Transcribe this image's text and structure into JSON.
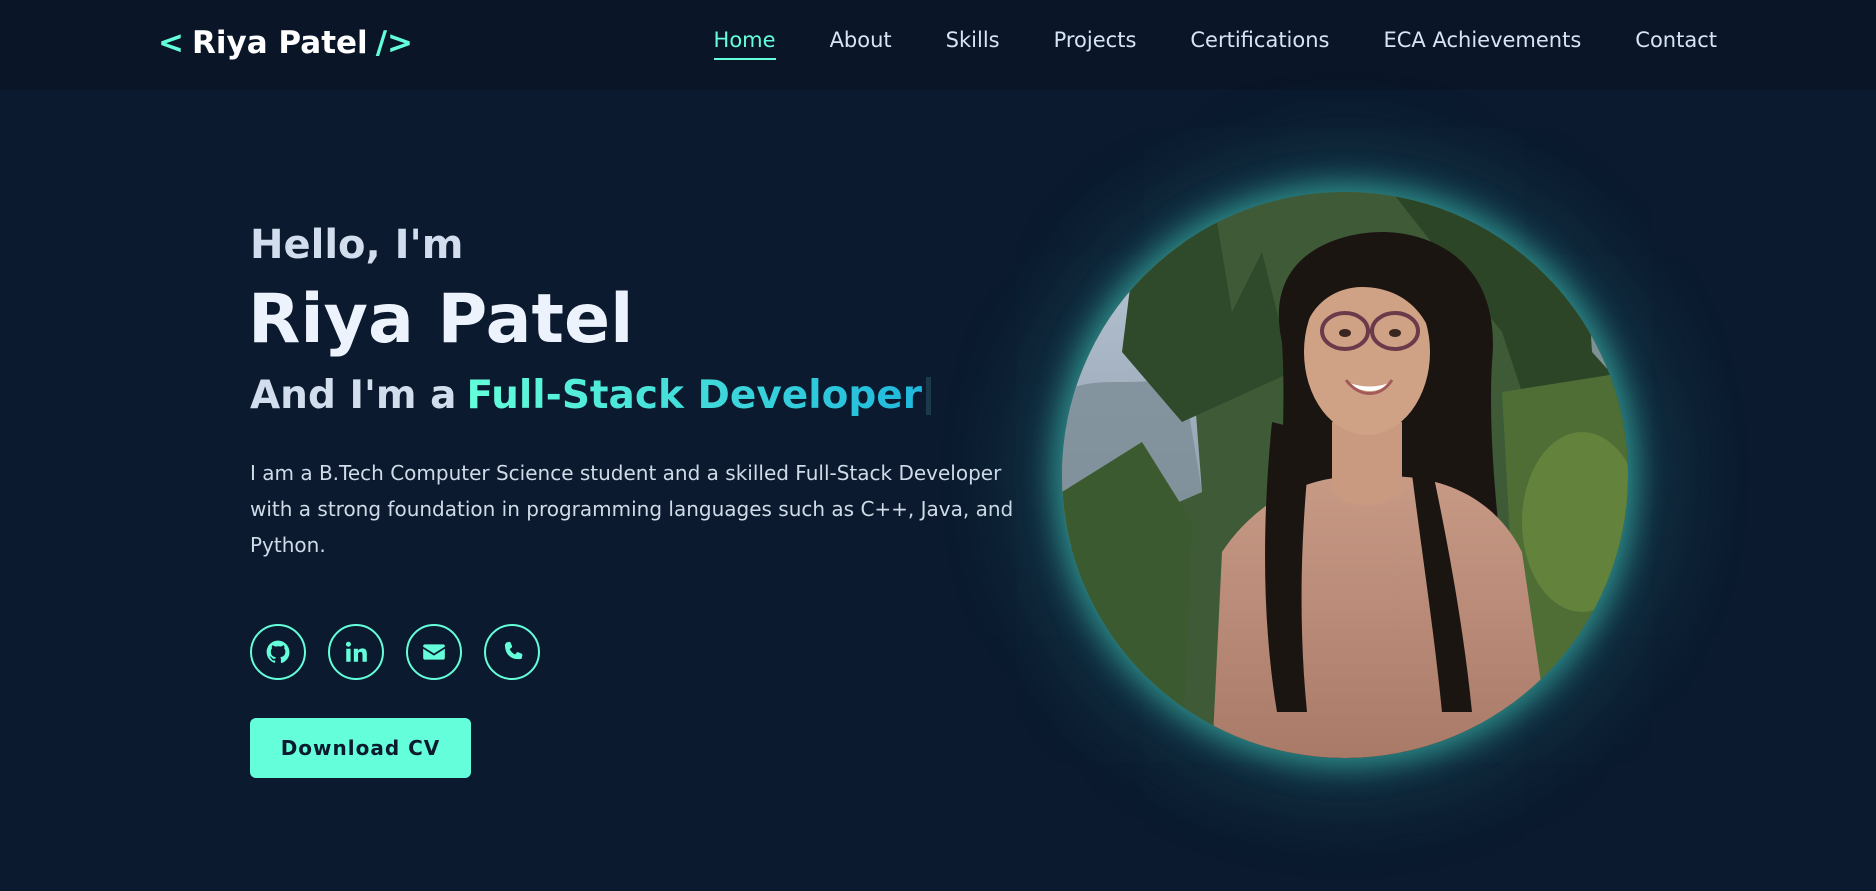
{
  "logo": {
    "open_bracket": "<",
    "text": "Riya Patel",
    "close_tag": "/>"
  },
  "nav": {
    "items": [
      {
        "label": "Home",
        "active": true
      },
      {
        "label": "About",
        "active": false
      },
      {
        "label": "Skills",
        "active": false
      },
      {
        "label": "Projects",
        "active": false
      },
      {
        "label": "Certifications",
        "active": false
      },
      {
        "label": "ECA Achievements",
        "active": false
      },
      {
        "label": "Contact",
        "active": false
      }
    ]
  },
  "hero": {
    "greeting": "Hello, I'm",
    "name": "Riya Patel",
    "role_prefix": "And I'm a",
    "role_typed": "Full-Stack Developer",
    "bio": "I am a B.Tech Computer Science student and a skilled Full-Stack Developer with a strong foundation in programming languages such as C++, Java, and Python.",
    "socials": [
      {
        "icon": "github-icon"
      },
      {
        "icon": "linkedin-icon"
      },
      {
        "icon": "envelope-icon"
      },
      {
        "icon": "phone-icon"
      }
    ],
    "cv_button": "Download CV",
    "photo_icon": "profile-photo"
  },
  "colors": {
    "background": "#0b1a2e",
    "navbar": "#0a1628",
    "accent": "#64ffda",
    "accent_gradient_end": "#1fb8dc",
    "text_primary": "#ecf3fc",
    "text_secondary": "#d2deee"
  }
}
